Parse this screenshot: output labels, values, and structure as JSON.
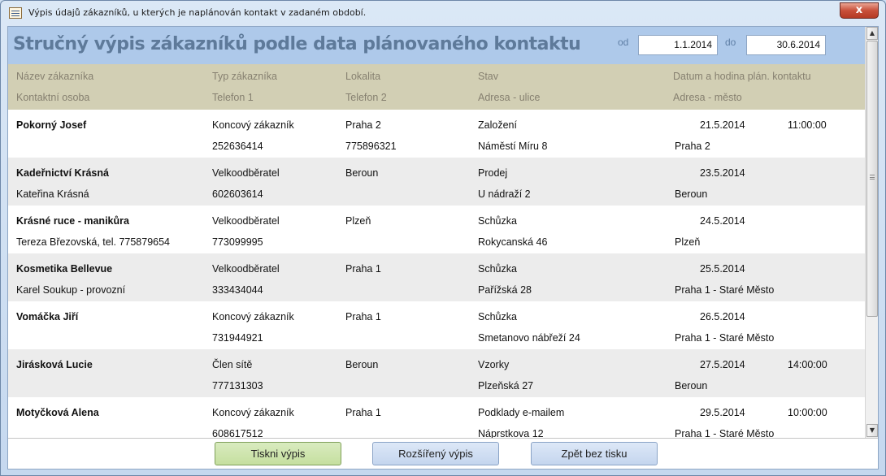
{
  "window": {
    "title": "Výpis údajů zákazníků, u kterých je naplánován kontakt v zadaném období.",
    "close_glyph": "x"
  },
  "report": {
    "title": "Stručný výpis zákazníků podle data plánovaného kontaktu",
    "from_label": "od",
    "from_value": "1.1.2014",
    "to_label": "do",
    "to_value": "30.6.2014"
  },
  "columns": {
    "row1": [
      "Název zákazníka",
      "Typ zákazníka",
      "Lokalita",
      "Stav",
      "Datum a hodina plán. kontaktu"
    ],
    "row2": [
      "Kontaktní osoba",
      "Telefon 1",
      "Telefon 2",
      "Adresa - ulice",
      "Adresa - město"
    ]
  },
  "records": [
    {
      "name": "Pokorný Josef",
      "type": "Koncový zákazník",
      "locality": "Praha 2",
      "status": "Založení",
      "date": "21.5.2014",
      "time": "11:00:00",
      "contact": "",
      "phone1": "252636414",
      "phone2": "775896321",
      "street": "Náměstí Míru 8",
      "city": "Praha 2"
    },
    {
      "name": "Kadeřnictví Krásná",
      "type": "Velkoodběratel",
      "locality": "Beroun",
      "status": "Prodej",
      "date": "23.5.2014",
      "time": "",
      "contact": "Kateřina Krásná",
      "phone1": "602603614",
      "phone2": "",
      "street": "U nádraží 2",
      "city": "Beroun"
    },
    {
      "name": "Krásné ruce - manikůra",
      "type": "Velkoodběratel",
      "locality": "Plzeň",
      "status": "Schůzka",
      "date": "24.5.2014",
      "time": "",
      "contact": "Tereza Březovská, tel. 775879654",
      "phone1": "773099995",
      "phone2": "",
      "street": "Rokycanská 46",
      "city": "Plzeň"
    },
    {
      "name": "Kosmetika Bellevue",
      "type": "Velkoodběratel",
      "locality": "Praha 1",
      "status": "Schůzka",
      "date": "25.5.2014",
      "time": "",
      "contact": "Karel Soukup - provozní",
      "phone1": "333434044",
      "phone2": "",
      "street": "Pařížská 28",
      "city": "Praha 1 - Staré Město"
    },
    {
      "name": "Vomáčka Jiří",
      "type": "Koncový zákazník",
      "locality": "Praha 1",
      "status": "Schůzka",
      "date": "26.5.2014",
      "time": "",
      "contact": "",
      "phone1": "731944921",
      "phone2": "",
      "street": "Smetanovo nábřeží 24",
      "city": "Praha 1 - Staré Město"
    },
    {
      "name": "Jirásková Lucie",
      "type": "Člen sítě",
      "locality": "Beroun",
      "status": "Vzorky",
      "date": "27.5.2014",
      "time": "14:00:00",
      "contact": "",
      "phone1": "777131303",
      "phone2": "",
      "street": "Plzeňská 27",
      "city": "Beroun"
    },
    {
      "name": "Motyčková Alena",
      "type": "Koncový zákazník",
      "locality": "Praha 1",
      "status": "Podklady e-mailem",
      "date": "29.5.2014",
      "time": "10:00:00",
      "contact": "",
      "phone1": "608617512",
      "phone2": "",
      "street": "Náprstkova 12",
      "city": "Praha 1 - Staré Město"
    }
  ],
  "buttons": {
    "print": "Tiskni výpis",
    "extended": "Rozšířený výpis",
    "back": "Zpět bez tisku"
  },
  "scrollbar": {
    "up_glyph": "▲",
    "down_glyph": "▼"
  }
}
